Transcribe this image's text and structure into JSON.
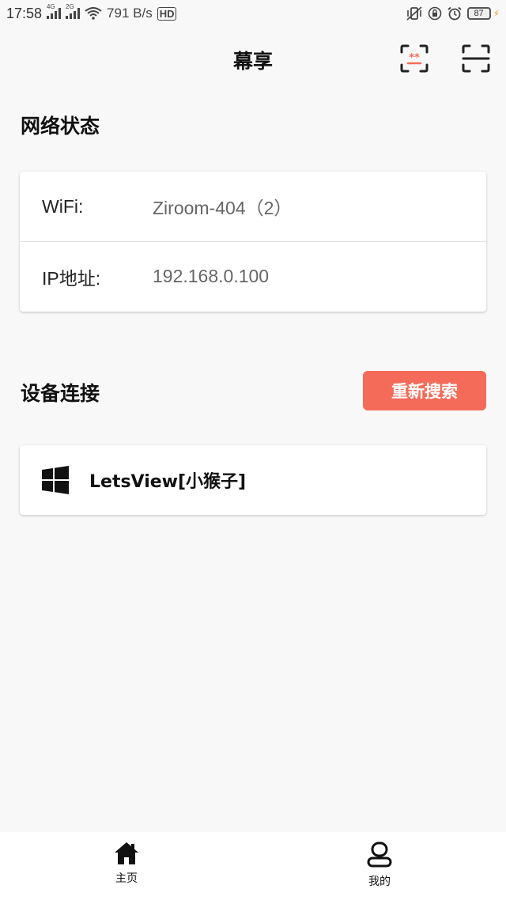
{
  "status_bar": {
    "time": "17:58",
    "signal_1_label": "4G",
    "signal_2_label": "2G",
    "net_speed": "791 B/s",
    "hd_label": "HD",
    "battery": "87"
  },
  "header": {
    "title": "幕享",
    "screen_icon": "screen-cast-icon",
    "scan_icon": "scan-icon"
  },
  "network": {
    "section_title": "网络状态",
    "rows": [
      {
        "label": "WiFi:",
        "value": "Ziroom-404（2）"
      },
      {
        "label": "IP地址:",
        "value": "192.168.0.100"
      }
    ]
  },
  "devices": {
    "section_title": "设备连接",
    "research_label": "重新搜索",
    "list": [
      {
        "name": "LetsView[小猴子]",
        "icon": "windows-icon"
      }
    ]
  },
  "bottom_nav": {
    "tabs": [
      {
        "label": "主页",
        "icon": "home-icon"
      },
      {
        "label": "我的",
        "icon": "profile-icon"
      }
    ]
  },
  "colors": {
    "accent": "#f56b5a",
    "background": "#f8f8f8"
  }
}
